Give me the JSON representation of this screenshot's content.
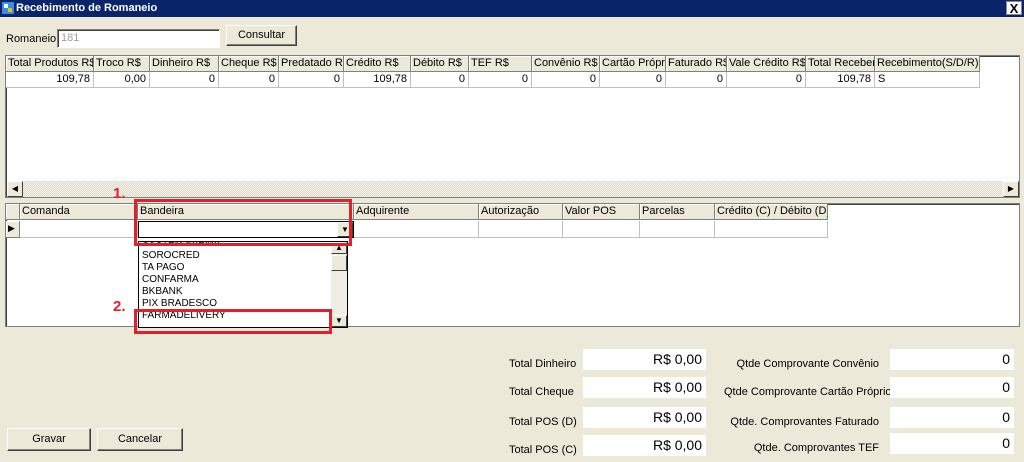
{
  "window": {
    "title": "Recebimento de Romaneio",
    "close_glyph": "X"
  },
  "romaneio": {
    "label": "Romaneio",
    "value": "181",
    "consult_label": "Consultar"
  },
  "totals_grid": {
    "columns": [
      "Total Produtos R$",
      "Troco R$",
      "Dinheiro R$",
      "Cheque R$",
      "Predatado R$",
      "Crédito R$",
      "Débito R$",
      "TEF R$",
      "Convênio R$",
      "Cartão Próprio",
      "Faturado R$",
      "Vale Crédito R$",
      "Total Receber",
      "Recebimento(S/D/R)"
    ],
    "rows": [
      [
        "109,78",
        "0,00",
        "0",
        "0",
        "0",
        "109,78",
        "0",
        "0",
        "0",
        "0",
        "0",
        "0",
        "109,78",
        "S"
      ]
    ]
  },
  "payment_grid": {
    "columns": [
      "Comanda",
      "Bandeira",
      "Adquirente",
      "Autorização",
      "Valor POS",
      "Parcelas",
      "Crédito (C) / Débito (D)"
    ],
    "row_indicator": "▶"
  },
  "bandeira_dropdown": {
    "options": [
      "SYSTEM FARMA",
      "SOROCRED",
      "TA PAGO",
      "CONFARMA",
      "BKBANK",
      "PIX BRADESCO",
      "FARMADELIVERY"
    ],
    "highlighted": "FARMADELIVERY"
  },
  "annotations": {
    "marker1": "1.",
    "marker2": "2."
  },
  "summary_left": [
    {
      "label": "Total Dinheiro",
      "value": "R$ 0,00"
    },
    {
      "label": "Total Cheque",
      "value": "R$ 0,00"
    },
    {
      "label": "Total POS (D)",
      "value": "R$ 0,00"
    },
    {
      "label": "Total POS (C)",
      "value": "R$ 0,00"
    }
  ],
  "summary_right": [
    {
      "label": "Qtde Comprovante Convênio",
      "value": "0"
    },
    {
      "label": "Qtde Comprovante Cartão Próprio",
      "value": "0"
    },
    {
      "label": "Qtde. Comprovantes Faturado",
      "value": "0"
    },
    {
      "label": "Qtde. Comprovantes TEF",
      "value": "0"
    }
  ],
  "actions": {
    "save_label": "Gravar",
    "cancel_label": "Cancelar"
  }
}
